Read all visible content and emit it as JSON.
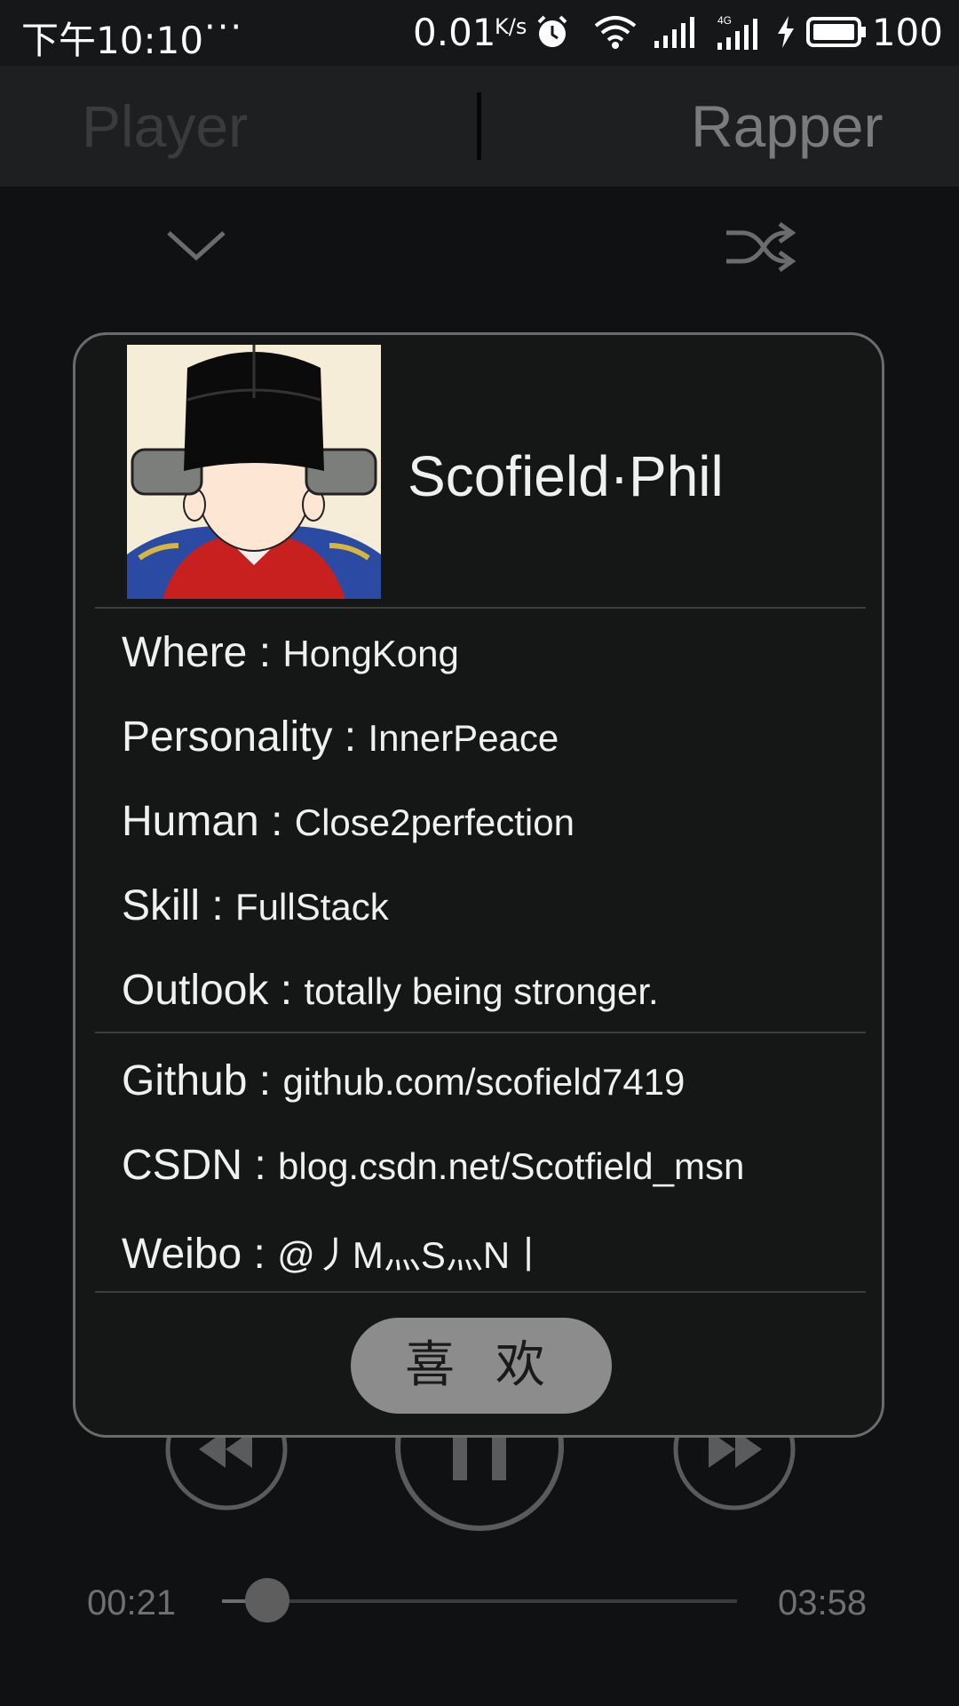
{
  "status_bar": {
    "left_text": "下午10:10",
    "dots": "···",
    "speed": "0.01",
    "speed_unit": "K/s",
    "battery": "100",
    "icons": [
      "alarm-icon",
      "wifi-icon",
      "signal-icon",
      "4g-signal-icon",
      "charging-icon",
      "battery-icon"
    ]
  },
  "header": {
    "tabs": [
      "Player",
      "Rapper"
    ]
  },
  "controls": {
    "icons": [
      "chevron-down-icon",
      "shuffle-icon"
    ]
  },
  "dialog": {
    "name": "Scofield·Phil",
    "info": [
      {
        "key": "Where : ",
        "value": "HongKong"
      },
      {
        "key": "Personality : ",
        "value": "InnerPeace"
      },
      {
        "key": "Human : ",
        "value": "Close2perfection"
      },
      {
        "key": "Skill : ",
        "value": "FullStack"
      },
      {
        "key": "Outlook : ",
        "value": "totally being stronger."
      }
    ],
    "links": [
      {
        "key": "Github : ",
        "value": "github.com/scofield7419"
      },
      {
        "key": "CSDN : ",
        "value": "blog.csdn.net/Scotfield_msn"
      },
      {
        "key": "Weibo : ",
        "value": "@丿M灬S灬N丨"
      }
    ],
    "like_button": "喜 欢"
  },
  "player": {
    "elapsed": "00:21",
    "duration": "03:58",
    "progress": 0.088,
    "icons": [
      "previous-icon",
      "pause-icon",
      "next-icon"
    ]
  },
  "colors": {
    "background": "#101112",
    "dialog_bg": "#151616",
    "button": "#8c8c8c"
  }
}
